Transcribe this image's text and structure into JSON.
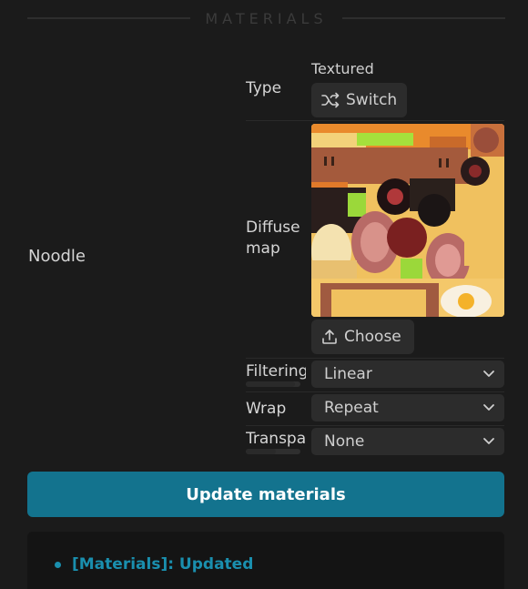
{
  "section": {
    "title": "MATERIALS"
  },
  "material": {
    "name": "Noodle"
  },
  "type": {
    "label": "Type",
    "value": "Textured",
    "switch_label": "Switch",
    "switch_icon": "shuffle-icon"
  },
  "diffuse": {
    "label": "Diffuse\nmap",
    "choose_label": "Choose",
    "choose_icon": "upload-icon"
  },
  "filtering": {
    "label": "Filtering",
    "value": "Linear",
    "progress": 0.9
  },
  "wrap": {
    "label": "Wrap",
    "value": "Repeat"
  },
  "transparency": {
    "label": "Transparency",
    "value": "None",
    "progress": 0.55
  },
  "actions": {
    "update_label": "Update materials"
  },
  "log": {
    "entries": [
      {
        "text": "[Materials]: Updated"
      }
    ]
  },
  "colors": {
    "accent": "#13738e",
    "log_text": "#1a8fae",
    "background": "#1b1b1b"
  }
}
